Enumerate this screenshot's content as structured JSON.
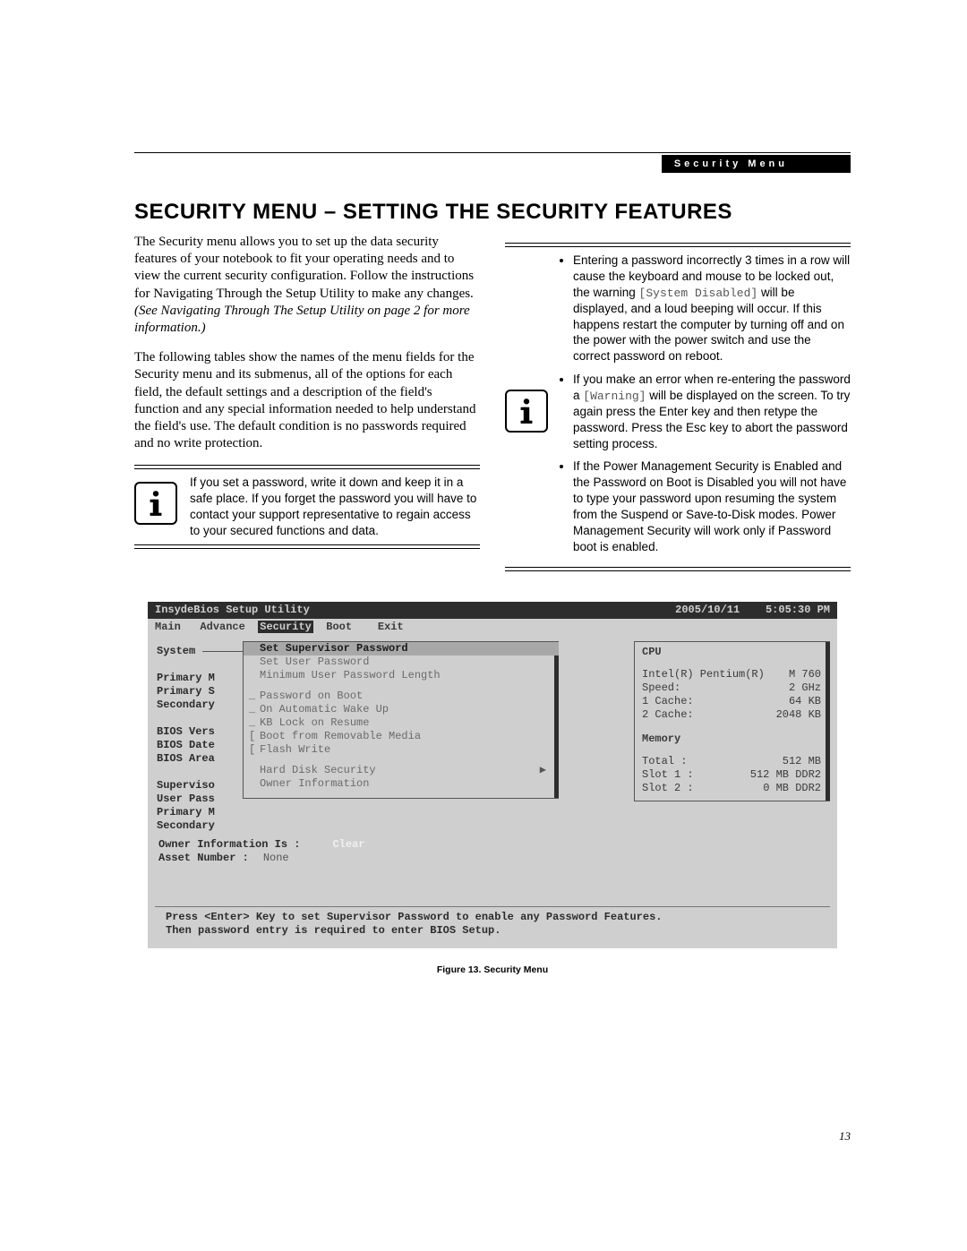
{
  "header_tab": "Security Menu",
  "title": "SECURITY MENU – SETTING THE SECURITY FEATURES",
  "left_col": {
    "para1_a": "The Security menu allows you to set up the data security features of your notebook to fit your operating needs and to view the current security configuration. Follow the instructions for Navigating Through the Setup Utility to make any changes. ",
    "para1_b_italic": "(See Navigating Through The Setup Utility on page 2 for more information.)",
    "para2": "The following tables show the names of the menu fields for the Security menu and its submenus, all of the options for each field, the default settings and a description of the field's function and any special information needed to help understand the field's use. The default condition is no passwords required and no write protection.",
    "callout": "If you set a password, write it down and keep it in a safe place. If you forget the password you will have to contact your support representative to regain access to your secured functions and data."
  },
  "right_col": {
    "b1_a": "Entering a password incorrectly 3 times in a row will cause the keyboard and mouse to be locked out, the warning ",
    "b1_code": "[System Disabled]",
    "b1_b": " will be displayed, and a loud beeping will occur. If this happens restart the computer by turning off and on the power with the power switch and use the correct password on reboot.",
    "b2_a": "If you make an error when re-entering the password a ",
    "b2_code": "[Warning]",
    "b2_b": " will be displayed on the screen. To try again press the Enter key and then retype the password. Press the Esc key to abort the password setting process.",
    "b3": "If the Power Management Security is Enabled and the Password on Boot is Disabled you will not have to type your password upon resuming the system from the Suspend or Save-to-Disk modes. Power Management Security will work only if Password boot is enabled."
  },
  "bios": {
    "title": "InsydeBios Setup Utility",
    "date": "2005/10/11",
    "time": "5:05:30 PM",
    "menu": {
      "main": "Main",
      "advance": "Advance",
      "security": "Security",
      "boot": "Boot",
      "exit": "Exit"
    },
    "left_rows": [
      "System",
      "",
      "Primary M",
      "Primary S",
      "Secondary",
      "",
      "BIOS Vers",
      "BIOS Date",
      "BIOS Area",
      "",
      "Superviso",
      "User Pass",
      "Primary M",
      "Secondary"
    ],
    "mid": {
      "r1": "Set Supervisor Password",
      "r2": "Set User Password",
      "r3": "Minimum User Password Length",
      "r5": "Password on Boot",
      "r6": "On Automatic Wake Up",
      "r7": "KB Lock on Resume",
      "r8": "Boot from Removable Media",
      "r9": "Flash Write",
      "r11": "Hard Disk Security",
      "r12": "Owner Information"
    },
    "right": {
      "grp1": "CPU",
      "cpu_name_a": "Intel(R) Pentium(R)",
      "cpu_name_b": "M 760",
      "speed_l": "Speed:",
      "speed_v": "2 GHz",
      "l1_l": "1 Cache:",
      "l1_v": "64 KB",
      "l2_l": "2 Cache:",
      "l2_v": "2048 KB",
      "grp2": "Memory",
      "tot_l": "Total :",
      "tot_v": "512 MB",
      "s1_l": "Slot 1 :",
      "s1_v": "512 MB DDR2",
      "s2_l": "Slot 2 :",
      "s2_v": "0 MB DDR2"
    },
    "lower": {
      "l1_label": "Owner Information Is :",
      "l1_val": "Clear",
      "l2_label": "Asset Number :",
      "l2_val": "None"
    },
    "help1": "Press <Enter> Key to set Supervisor Password to enable any Password Features.",
    "help2": "Then password entry is required to enter BIOS Setup."
  },
  "figure_caption": "Figure 13.  Security Menu",
  "page_number": "13"
}
